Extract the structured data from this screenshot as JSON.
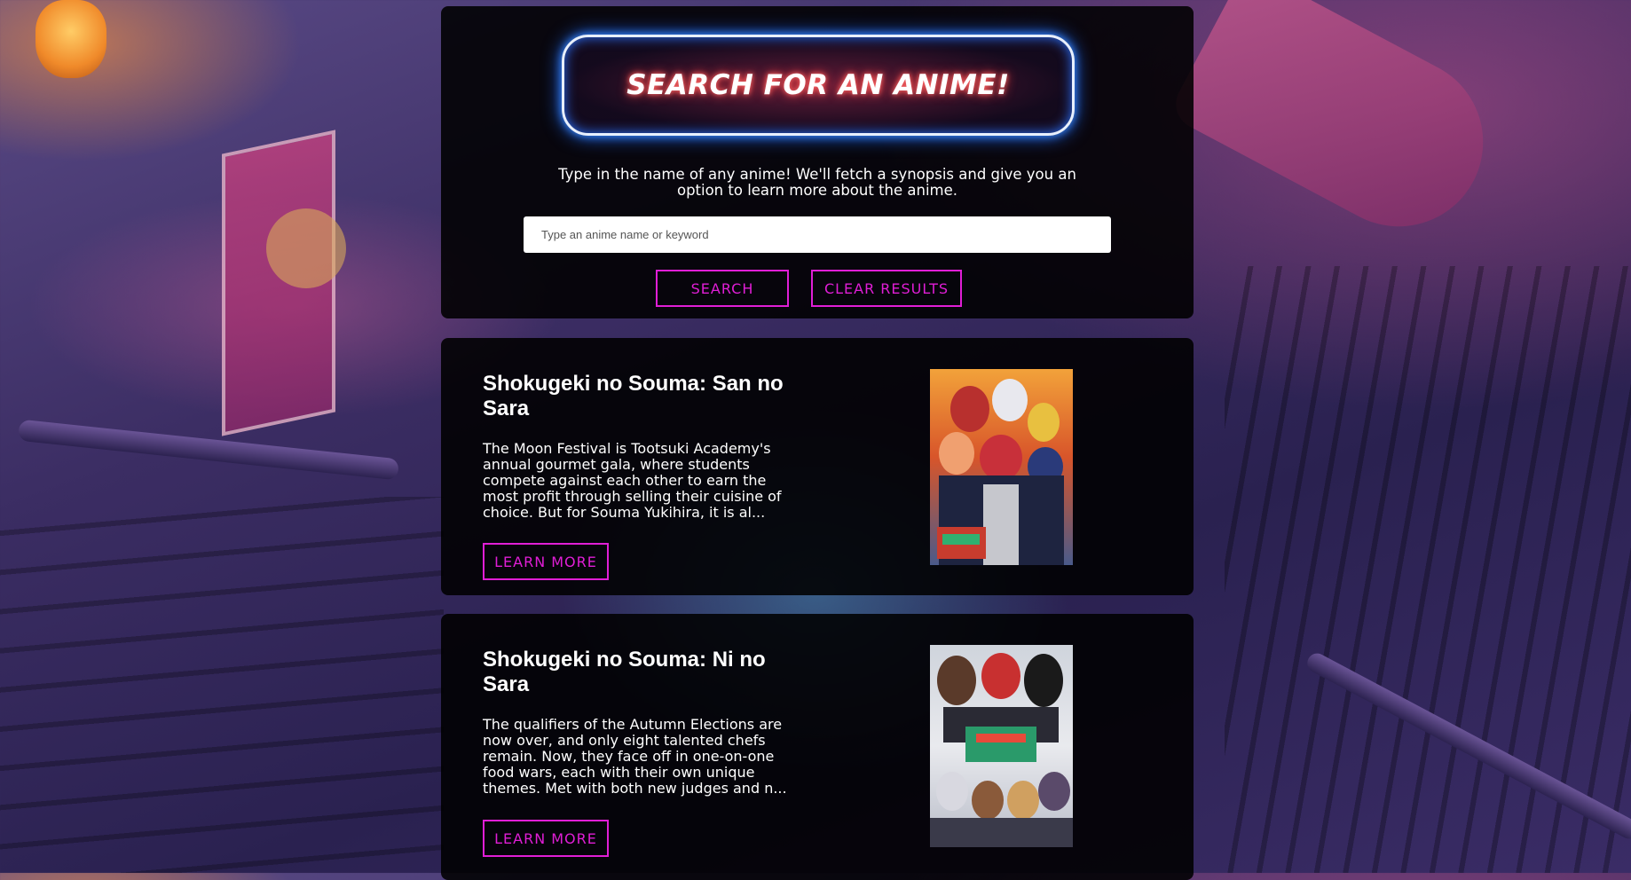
{
  "search": {
    "title": "SEARCH FOR AN ANIME!",
    "intro": "Type in the name of any anime! We'll fetch a synopsis and give you an option to learn more about the anime.",
    "placeholder": "Type an anime name or keyword",
    "value": "",
    "search_label": "SEARCH",
    "clear_label": "CLEAR RESULTS"
  },
  "results": [
    {
      "title": "Shokugeki no Souma: San no Sara",
      "synopsis": "The Moon Festival is Tootsuki Academy's annual gourmet gala, where students compete against each other to earn the most profit through selling their cuisine of choice. But for Souma Yukihira, it is al...",
      "learn_more_label": "LEARN MORE"
    },
    {
      "title": "Shokugeki no Souma: Ni no Sara",
      "synopsis": "The qualifiers of the Autumn Elections are now over, and only eight talented chefs remain. Now, they face off in one-on-one food wars, each with their own unique themes. Met with both new judges and n...",
      "learn_more_label": "LEARN MORE"
    }
  ],
  "colors": {
    "neon_pink": "#e01ed6",
    "neon_blue": "#1f6cff",
    "panel": "#000000"
  }
}
